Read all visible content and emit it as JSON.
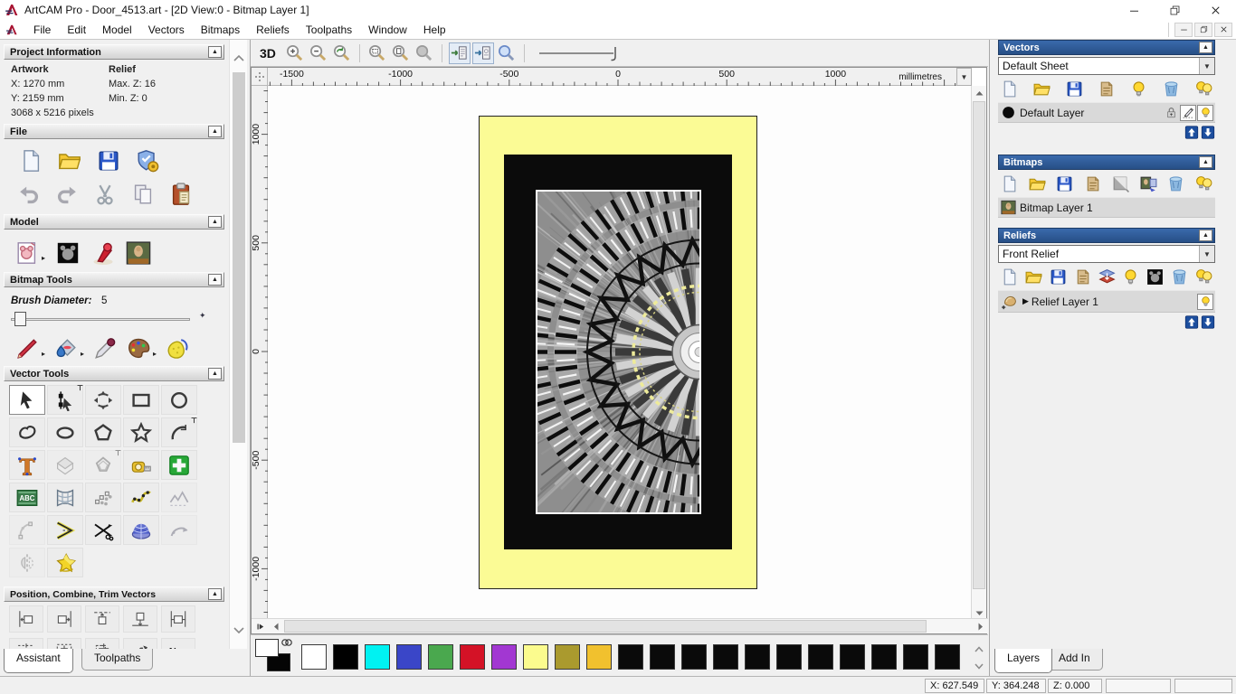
{
  "window": {
    "title": "ArtCAM Pro - Door_4513.art - [2D View:0 - Bitmap Layer 1]"
  },
  "menu": {
    "items": [
      "File",
      "Edit",
      "Model",
      "Vectors",
      "Bitmaps",
      "Reliefs",
      "Toolpaths",
      "Window",
      "Help"
    ]
  },
  "assistant": {
    "tabs": [
      {
        "label": "Assistant"
      },
      {
        "label": "Toolpaths"
      }
    ],
    "project_information": {
      "title": "Project Information",
      "artwork_label": "Artwork",
      "relief_label": "Relief",
      "x": "X: 1270 mm",
      "y": "Y: 2159 mm",
      "pixels": "3068 x 5216 pixels",
      "max_z": "Max. Z: 16",
      "min_z": "Min. Z: 0"
    },
    "file": {
      "title": "File",
      "rows": [
        [
          {
            "name": "new-model"
          },
          {
            "name": "open-model"
          },
          {
            "name": "save-model"
          },
          {
            "name": "model-wizard"
          }
        ],
        [
          {
            "name": "undo"
          },
          {
            "name": "redo"
          },
          {
            "name": "cut"
          },
          {
            "name": "copy"
          },
          {
            "name": "paste"
          }
        ]
      ]
    },
    "model": {
      "title": "Model",
      "icons": [
        {
          "name": "edit-model",
          "flyout": true
        },
        {
          "name": "greyscale-model"
        },
        {
          "name": "set-lighting"
        },
        {
          "name": "add-texture"
        }
      ]
    },
    "bitmap_tools": {
      "title": "Bitmap Tools",
      "brush_label": "Brush Diameter:",
      "brush_value": "5",
      "icons": [
        {
          "name": "paint-brush",
          "flyout": true
        },
        {
          "name": "flood-fill",
          "flyout": true
        },
        {
          "name": "colour-picker"
        },
        {
          "name": "palette",
          "flyout": true
        },
        {
          "name": "texture-flood"
        }
      ]
    },
    "vector_tools": {
      "title": "Vector Tools",
      "rows": [
        [
          {
            "name": "select",
            "state": "selected"
          },
          {
            "name": "node-editing",
            "pin": true
          },
          {
            "name": "transform"
          },
          {
            "name": "create-rectangle"
          },
          {
            "name": "create-circle"
          }
        ],
        [
          {
            "name": "create-polyline"
          },
          {
            "name": "create-ellipse"
          },
          {
            "name": "create-polygon"
          },
          {
            "name": "create-star"
          },
          {
            "name": "create-arc",
            "pin": true
          }
        ],
        [
          {
            "name": "create-text"
          },
          {
            "name": "block-copy",
            "state": "disabled"
          },
          {
            "name": "offset-vector",
            "state": "disabled",
            "pin": true
          },
          {
            "name": "measure"
          },
          {
            "name": "vector-doctor"
          }
        ],
        [
          {
            "name": "paste-text-along-curve"
          },
          {
            "name": "envelope-distortion"
          },
          {
            "name": "paste-along-curve"
          },
          {
            "name": "fit-curve-to-points"
          },
          {
            "name": "simplify-vectors",
            "state": "disabled"
          }
        ],
        [
          {
            "name": "fit-arcs",
            "state": "disabled"
          },
          {
            "name": "create-bisector"
          },
          {
            "name": "trim-vectors"
          },
          {
            "name": "extrude"
          },
          {
            "name": "free-form",
            "state": "disabled"
          }
        ],
        [
          {
            "name": "mirror-vectors",
            "state": "disabled"
          },
          {
            "name": "vector-wizard"
          }
        ]
      ]
    },
    "position": {
      "title": "Position, Combine, Trim Vectors",
      "rows": [
        [
          {
            "name": "align-left-edge"
          },
          {
            "name": "align-right-edge"
          },
          {
            "name": "align-top-edge"
          },
          {
            "name": "align-bottom-edge"
          },
          {
            "name": "align-centre-width"
          }
        ],
        [
          {
            "name": "align-centre-height"
          },
          {
            "name": "centre-in-page"
          },
          {
            "name": "align-centres"
          },
          {
            "name": "nest-preview"
          },
          {
            "name": "nesting"
          }
        ]
      ]
    }
  },
  "canvas": {
    "toolbar": {
      "label_3d": "3D",
      "groups": [
        [
          {
            "name": "zoom-in"
          },
          {
            "name": "zoom-out"
          },
          {
            "name": "zoom-last"
          }
        ],
        [
          {
            "name": "zoom-rect"
          },
          {
            "name": "zoom-drawing"
          },
          {
            "name": "zoom-object"
          }
        ],
        [
          {
            "name": "toggle-bitmap-view",
            "state": "pressed"
          },
          {
            "name": "toggle-vector-view",
            "state": "pressed"
          },
          {
            "name": "interrogate"
          }
        ]
      ]
    },
    "ruler": {
      "unit": "millimetres",
      "h_labels": [
        -1500,
        -1000,
        -500,
        0,
        500,
        1000
      ],
      "v_labels": [
        1000,
        500,
        0,
        -500,
        -1000
      ]
    },
    "palette": {
      "colors": [
        "#ffffff",
        "#000000",
        "#00f2f2",
        "#3a46c8",
        "#4aa84e",
        "#d41226",
        "#a237d2",
        "#fbfb8e",
        "#aa9a2e",
        "#f1c12e",
        "#0a0a0a",
        "#0a0a0a",
        "#0a0a0a",
        "#0a0a0a",
        "#0a0a0a",
        "#0a0a0a",
        "#0a0a0a",
        "#0a0a0a",
        "#0a0a0a",
        "#0a0a0a",
        "#0a0a0a"
      ]
    }
  },
  "layers_panel": {
    "tabs": [
      {
        "label": "Layers"
      },
      {
        "label": "Add In"
      }
    ],
    "vectors": {
      "title": "Vectors",
      "sheet": "Default Sheet",
      "toolbar": [
        {
          "name": "new-layer"
        },
        {
          "name": "open-layer"
        },
        {
          "name": "save-layer"
        },
        {
          "name": "merge-layers"
        },
        {
          "name": "toggle-visibility"
        },
        {
          "name": "delete-layer"
        },
        {
          "name": "toggle-all-visibility"
        }
      ],
      "layer": {
        "name": "Default Layer"
      }
    },
    "bitmaps": {
      "title": "Bitmaps",
      "toolbar": [
        {
          "name": "new-layer"
        },
        {
          "name": "open-layer"
        },
        {
          "name": "save-layer"
        },
        {
          "name": "merge-layers"
        },
        {
          "name": "greyscale-preview"
        },
        {
          "name": "convert-bitmap"
        },
        {
          "name": "delete-layer"
        },
        {
          "name": "toggle-all-visibility"
        }
      ],
      "layer": {
        "name": "Bitmap Layer 1"
      }
    },
    "reliefs": {
      "title": "Reliefs",
      "combo": "Front Relief",
      "toolbar": [
        {
          "name": "new-layer"
        },
        {
          "name": "open-layer"
        },
        {
          "name": "save-layer"
        },
        {
          "name": "merge-layers"
        },
        {
          "name": "combine-layers"
        },
        {
          "name": "toggle-visibility"
        },
        {
          "name": "greyscale-model"
        },
        {
          "name": "delete-layer"
        },
        {
          "name": "toggle-all-visibility"
        }
      ],
      "layer": {
        "name": "Relief Layer 1"
      }
    }
  },
  "status_bar": {
    "x": "X: 627.549",
    "y": "Y: 364.248",
    "z": "Z: 0.000"
  }
}
